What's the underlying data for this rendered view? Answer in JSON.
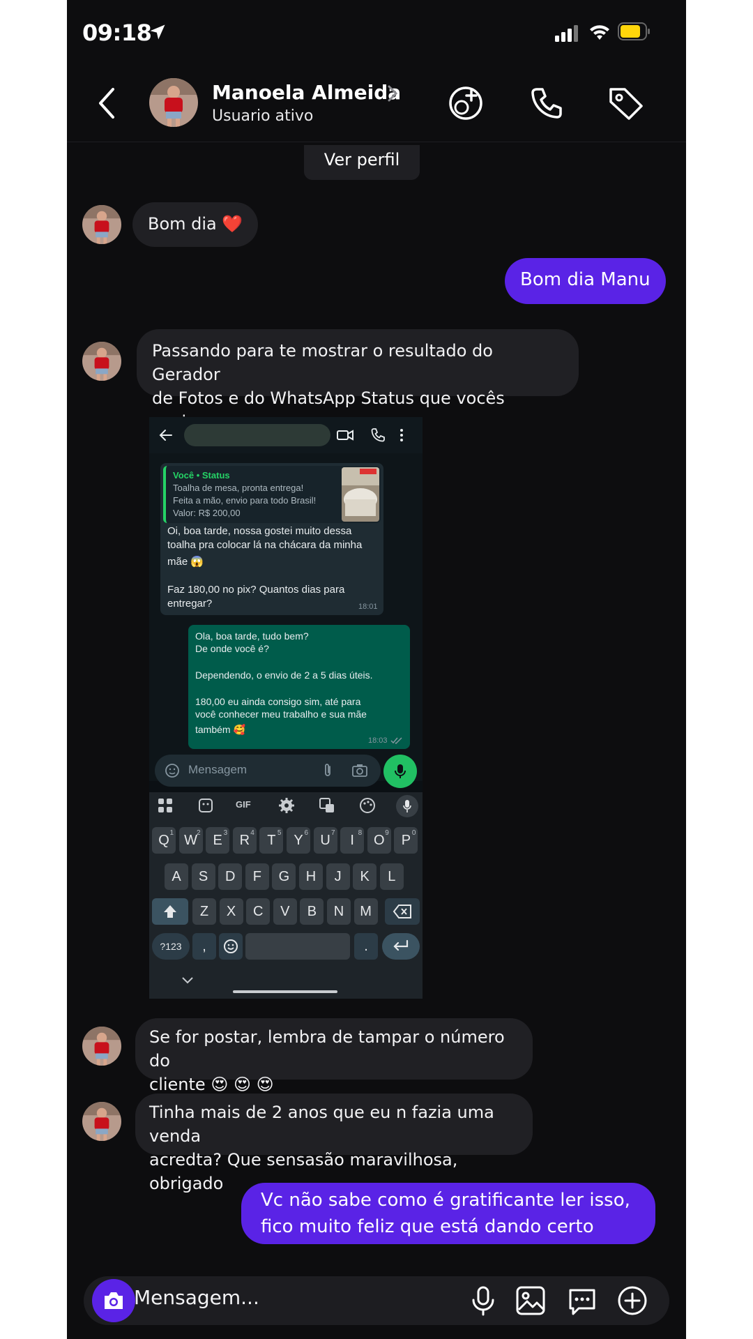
{
  "status_bar": {
    "time": "09:18"
  },
  "header": {
    "name": "Manoela Almeida",
    "status": "Usuario ativo"
  },
  "chat": {
    "view_profile": "Ver perfil",
    "m1": "Bom dia ❤️",
    "m2": "Bom dia Manu",
    "m3_l1": "Passando para te mostrar o resultado do Gerador",
    "m3_l2": "de Fotos e do WhatsApp Status que vocês ensinam",
    "m4_l1": "Se for postar, lembra de tampar o número do",
    "m4_l2": "cliente 😍 😍 😍",
    "m5_l1": "Tinha mais de 2 anos que eu n fazia uma venda",
    "m5_l2": "acredta? Que sensasão maravilhosa, obrigado",
    "m6_l1": "Vc não sabe como é gratificante ler isso,",
    "m6_l2": "fico muito feliz que está dando certo"
  },
  "screenshot": {
    "quote_title": "Você • Status",
    "quote_l1": "Toalha de mesa, pronta entrega!",
    "quote_l2": "Feita a mão, envio para todo Brasil!",
    "quote_l3": "Valor: R$ 200,00",
    "in_l1": "Oi, boa tarde, nossa gostei muito dessa",
    "in_l2": "toalha pra colocar lá na chácara da minha",
    "in_l3": "mãe 😱",
    "in_l4": "Faz 180,00 no pix? Quantos dias para",
    "in_l5": "entregar?",
    "in_time": "18:01",
    "out_l1": "Ola, boa tarde, tudo bem?",
    "out_l2": "De onde você é?",
    "out_l3": " Dependendo, o envio de 2 a 5 dias úteis.",
    "out_l4": "180,00 eu ainda consigo sim, até para",
    "out_l5": "você conhecer meu trabalho e sua mãe",
    "out_l6": "também 🥰",
    "out_time": "18:03",
    "input_placeholder": "Mensagem",
    "keyboard": {
      "row1": [
        "Q",
        "W",
        "E",
        "R",
        "T",
        "Y",
        "U",
        "I",
        "O",
        "P"
      ],
      "row1_sup": [
        "1",
        "2",
        "3",
        "4",
        "5",
        "6",
        "7",
        "8",
        "9",
        "0"
      ],
      "row2": [
        "A",
        "S",
        "D",
        "F",
        "G",
        "H",
        "J",
        "K",
        "L"
      ],
      "row3": [
        "Z",
        "X",
        "C",
        "V",
        "B",
        "N",
        "M"
      ],
      "sym": "?123",
      "comma": ",",
      "period": ".",
      "gif": "GIF"
    }
  },
  "composer": {
    "placeholder": "Mensagem..."
  },
  "colors": {
    "accent": "#5a23e6",
    "whatsapp_green": "#25d366"
  }
}
